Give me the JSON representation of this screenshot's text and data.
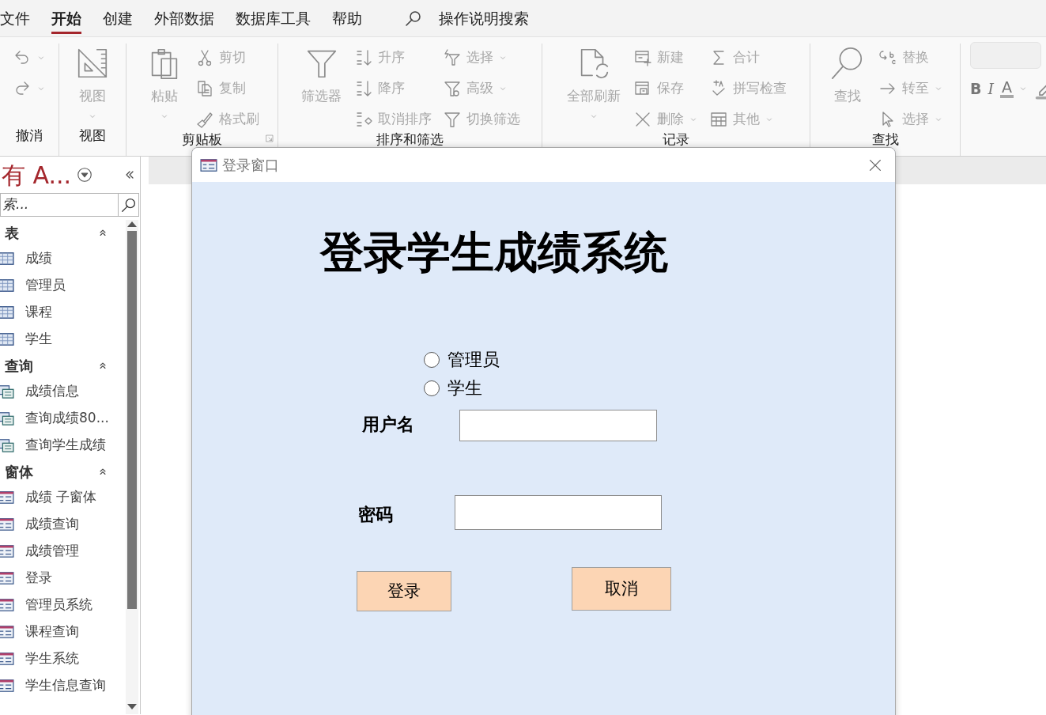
{
  "menu_tabs": [
    {
      "label": "文件",
      "selected": false
    },
    {
      "label": "开始",
      "selected": true
    },
    {
      "label": "创建",
      "selected": false
    },
    {
      "label": "外部数据",
      "selected": false
    },
    {
      "label": "数据库工具",
      "selected": false
    },
    {
      "label": "帮助",
      "selected": false
    }
  ],
  "tell_me": {
    "label": "操作说明搜索"
  },
  "ribbon": {
    "groups": [
      {
        "label": "撤消",
        "columns": [
          [
            {
              "kind": "undo",
              "dropdown": true,
              "disabled": true
            },
            {
              "kind": "redo",
              "dropdown": true,
              "disabled": true
            }
          ]
        ]
      },
      {
        "label": "视图",
        "large": [
          {
            "text": "视图",
            "kind": "view",
            "dropdown": true,
            "disabled": true
          }
        ]
      },
      {
        "label": "剪贴板",
        "launcher": true,
        "large": [
          {
            "text": "粘贴",
            "kind": "paste",
            "dropdown": true,
            "disabled": true
          }
        ],
        "columns": [
          [
            {
              "text": "剪切",
              "kind": "cut",
              "disabled": true
            },
            {
              "text": "复制",
              "kind": "copy",
              "disabled": true
            },
            {
              "text": "格式刷",
              "kind": "brush",
              "disabled": true
            }
          ]
        ]
      },
      {
        "label": "排序和筛选",
        "large": [
          {
            "text": "筛选器",
            "kind": "filter",
            "disabled": true
          }
        ],
        "columns": [
          [
            {
              "text": "升序",
              "kind": "asc",
              "disabled": true
            },
            {
              "text": "降序",
              "kind": "desc",
              "disabled": true
            },
            {
              "text": "取消排序",
              "kind": "clearsort",
              "disabled": true
            }
          ],
          [
            {
              "text": "选择",
              "kind": "selfilter",
              "dropdown": true,
              "disabled": true
            },
            {
              "text": "高级",
              "kind": "advfilter",
              "dropdown": true,
              "disabled": true
            },
            {
              "text": "切换筛选",
              "kind": "filter",
              "disabled": true
            }
          ]
        ]
      },
      {
        "label": "记录",
        "large": [
          {
            "text": "全部刷新",
            "kind": "refresh",
            "dropdown": true,
            "disabled": true
          }
        ],
        "columns": [
          [
            {
              "text": "新建",
              "kind": "newrec",
              "disabled": true
            },
            {
              "text": "保存",
              "kind": "save",
              "disabled": true
            },
            {
              "text": "删除",
              "kind": "delete",
              "dropdown": true,
              "disabled": true
            }
          ],
          [
            {
              "text": "合计",
              "kind": "sum",
              "disabled": true
            },
            {
              "text": "拼写检查",
              "kind": "spell",
              "disabled": true
            },
            {
              "text": "其他",
              "kind": "more",
              "dropdown": true,
              "disabled": true
            }
          ]
        ]
      },
      {
        "label": "查找",
        "large": [
          {
            "text": "查找",
            "kind": "find",
            "disabled": true
          }
        ],
        "columns": [
          [
            {
              "text": "替换",
              "kind": "replace",
              "disabled": true
            },
            {
              "text": "转至",
              "kind": "goto",
              "dropdown": true,
              "disabled": true
            },
            {
              "text": "选择",
              "kind": "select",
              "dropdown": true,
              "disabled": true
            }
          ]
        ]
      }
    ],
    "format": [
      {
        "kind": "bold",
        "text": "B"
      },
      {
        "kind": "italic",
        "text": "I"
      },
      {
        "kind": "font-color",
        "text": "A",
        "dropdown": true
      },
      {
        "kind": "highlight"
      }
    ]
  },
  "nav_pane": {
    "title": "有 A...",
    "search": {
      "placeholder": "索..."
    },
    "groups": [
      {
        "label": "表",
        "expanded": true,
        "items": [
          {
            "label": "成绩",
            "kind": "table"
          },
          {
            "label": "管理员",
            "kind": "table"
          },
          {
            "label": "课程",
            "kind": "table"
          },
          {
            "label": "学生",
            "kind": "table"
          }
        ]
      },
      {
        "label": "查询",
        "expanded": true,
        "items": [
          {
            "label": "成绩信息",
            "kind": "query"
          },
          {
            "label": "查询成绩80...",
            "kind": "query"
          },
          {
            "label": "查询学生成绩",
            "kind": "query"
          }
        ]
      },
      {
        "label": "窗体",
        "expanded": true,
        "items": [
          {
            "label": "成绩 子窗体",
            "kind": "form"
          },
          {
            "label": "成绩查询",
            "kind": "form"
          },
          {
            "label": "成绩管理",
            "kind": "form"
          },
          {
            "label": "登录",
            "kind": "form"
          },
          {
            "label": "管理员系统",
            "kind": "form"
          },
          {
            "label": "课程查询",
            "kind": "form"
          },
          {
            "label": "学生系统",
            "kind": "form"
          },
          {
            "label": "学生信息查询",
            "kind": "form"
          }
        ]
      }
    ]
  },
  "dialog": {
    "title": "登录窗口",
    "heading": "登录学生成绩系统",
    "roles": [
      {
        "label": "管理员",
        "selected": false
      },
      {
        "label": "学生",
        "selected": false
      }
    ],
    "fields": [
      {
        "label": "用户名"
      },
      {
        "label": "密码"
      }
    ],
    "buttons": [
      {
        "label": "登录"
      },
      {
        "label": "取消"
      }
    ]
  }
}
